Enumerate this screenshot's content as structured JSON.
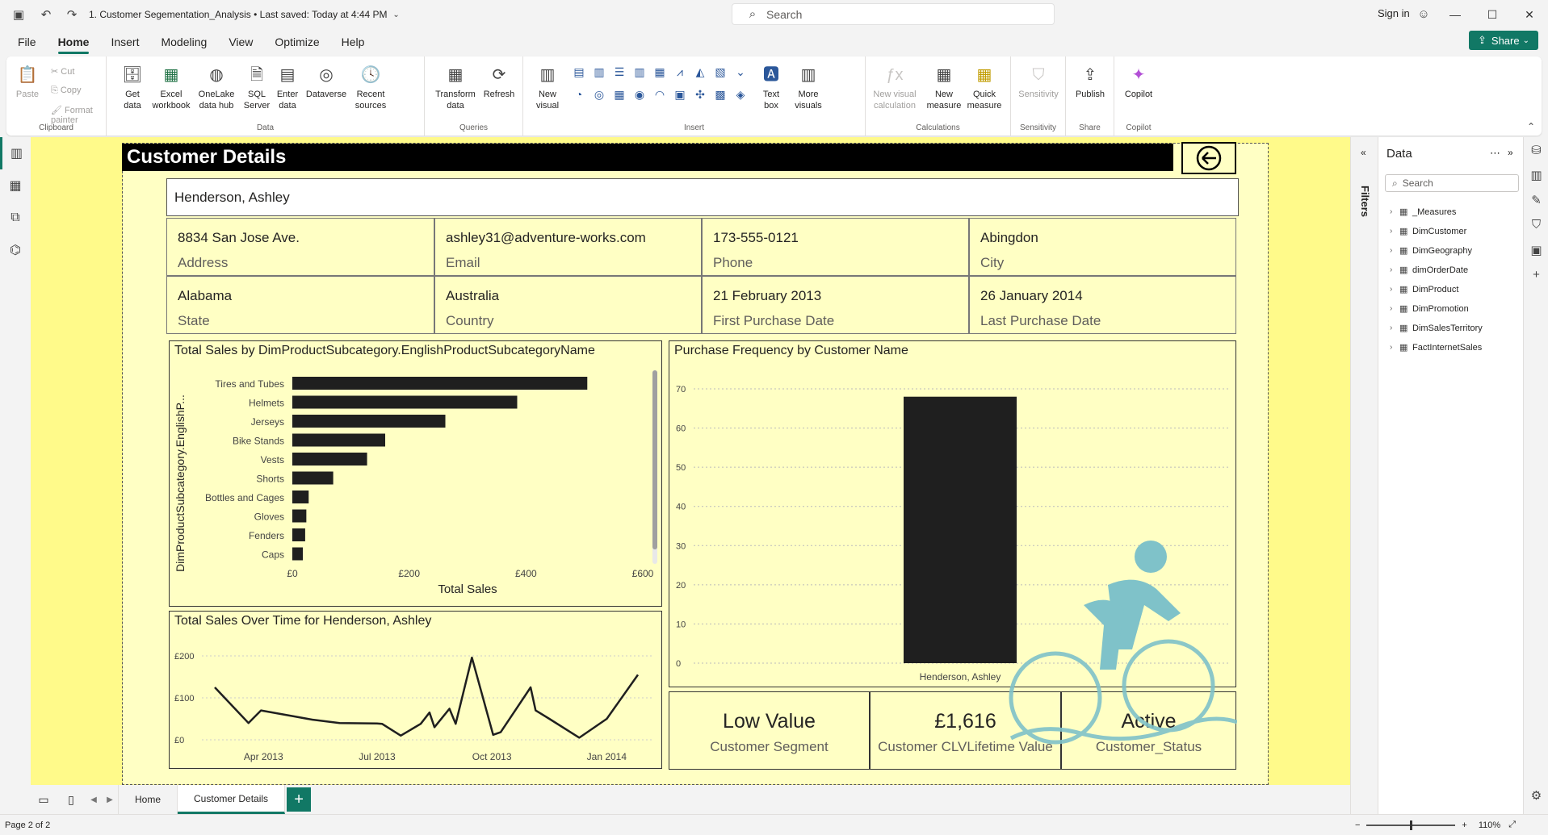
{
  "titlebar": {
    "doc_title": "1. Customer Segementation_Analysis • Last saved: Today at 4:44 PM",
    "search_placeholder": "Search",
    "signin": "Sign in"
  },
  "menu": {
    "items": [
      "File",
      "Home",
      "Insert",
      "Modeling",
      "View",
      "Optimize",
      "Help"
    ],
    "active": "Home",
    "share_label": "Share"
  },
  "ribbon": {
    "clipboard": {
      "paste": "Paste",
      "cut": "Cut",
      "copy": "Copy",
      "format_painter": "Format painter",
      "label": "Clipboard"
    },
    "data": {
      "get_data": "Get data",
      "excel": "Excel workbook",
      "onelake": "OneLake data hub",
      "sql": "SQL Server",
      "enter": "Enter data",
      "dataverse": "Dataverse",
      "recent": "Recent sources",
      "label": "Data"
    },
    "queries": {
      "transform": "Transform data",
      "refresh": "Refresh",
      "label": "Queries"
    },
    "insert": {
      "new_visual": "New visual",
      "text_box": "Text box",
      "more_visuals": "More visuals",
      "label": "Insert"
    },
    "calculations": {
      "new_visual_calc": "New visual calculation",
      "new_measure": "New measure",
      "quick_measure": "Quick measure",
      "label": "Calculations"
    },
    "sensitivity": {
      "btn": "Sensitivity",
      "label": "Sensitivity"
    },
    "share": {
      "publish": "Publish",
      "label": "Share"
    },
    "copilot": {
      "btn": "Copilot",
      "label": "Copilot"
    }
  },
  "report": {
    "header": "Customer Details",
    "customer_name": "Henderson, Ashley",
    "cards": [
      {
        "value": "8834 San Jose Ave.",
        "label": "Address"
      },
      {
        "value": "ashley31@adventure-works.com",
        "label": "Email"
      },
      {
        "value": "173-555-0121",
        "label": "Phone"
      },
      {
        "value": "Abingdon",
        "label": "City"
      },
      {
        "value": "Alabama",
        "label": "State"
      },
      {
        "value": "Australia",
        "label": "Country"
      },
      {
        "value": "21 February 2013",
        "label": "First Purchase Date"
      },
      {
        "value": "26 January 2014",
        "label": "Last Purchase Date"
      }
    ],
    "kpis": [
      {
        "value": "Low Value",
        "label": "Customer Segment"
      },
      {
        "value": "£1,616",
        "label": "Customer CLVLifetime Value"
      },
      {
        "value": "Active",
        "label": "Customer_Status"
      }
    ]
  },
  "chart_data": [
    {
      "type": "bar",
      "orientation": "horizontal",
      "title": "Total Sales by DimProductSubcategory.EnglishProductSubcategoryName",
      "xlabel": "Total Sales",
      "ylabel": "DimProductSubcategory.EnglishP...",
      "categories": [
        "Tires and Tubes",
        "Helmets",
        "Jerseys",
        "Bike Stands",
        "Vests",
        "Shorts",
        "Bottles and Cages",
        "Gloves",
        "Fenders",
        "Caps"
      ],
      "values": [
        505,
        385,
        262,
        159,
        128,
        70,
        28,
        24,
        22,
        18
      ],
      "xlim": [
        0,
        600
      ],
      "xticks": [
        "£0",
        "£200",
        "£400",
        "£600"
      ],
      "color": "#1f1f1f"
    },
    {
      "type": "bar",
      "title": "Purchase Frequency by Customer Name",
      "categories": [
        "Henderson, Ashley"
      ],
      "values": [
        68
      ],
      "ylim": [
        0,
        70
      ],
      "yticks": [
        "0",
        "10",
        "20",
        "30",
        "40",
        "50",
        "60",
        "70"
      ],
      "color": "#1f1f1f"
    },
    {
      "type": "line",
      "title": "Total Sales Over Time for Henderson, Ashley",
      "x": [
        "2013-02-21",
        "2013-03-20",
        "2013-03-30",
        "2013-05-10",
        "2013-06-01",
        "2013-07-01",
        "2013-07-05",
        "2013-07-20",
        "2013-08-05",
        "2013-08-12",
        "2013-08-16",
        "2013-08-28",
        "2013-09-02",
        "2013-09-15",
        "2013-10-02",
        "2013-10-08",
        "2013-11-01",
        "2013-11-05",
        "2013-11-16",
        "2013-12-10",
        "2014-01-01",
        "2014-01-26"
      ],
      "y": [
        125,
        40,
        70,
        48,
        40,
        39,
        38,
        10,
        38,
        65,
        30,
        74,
        38,
        196,
        12,
        18,
        125,
        70,
        50,
        5,
        50,
        155,
        80
      ],
      "ylim": [
        0,
        200
      ],
      "yticks": [
        "£0",
        "£100",
        "£200"
      ],
      "xticks": [
        "Apr 2013",
        "Jul 2013",
        "Oct 2013",
        "Jan 2014"
      ],
      "color": "#1f1f1f"
    }
  ],
  "pages": {
    "tabs": [
      "Home",
      "Customer Details"
    ],
    "active": "Customer Details"
  },
  "statusbar": {
    "page": "Page 2 of 2",
    "zoom": "110%"
  },
  "filters_label": "Filters",
  "data_pane": {
    "title": "Data",
    "search_placeholder": "Search",
    "tables": [
      "_Measures",
      "DimCustomer",
      "DimGeography",
      "dimOrderDate",
      "DimProduct",
      "DimPromotion",
      "DimSalesTerritory",
      "FactInternetSales"
    ]
  }
}
